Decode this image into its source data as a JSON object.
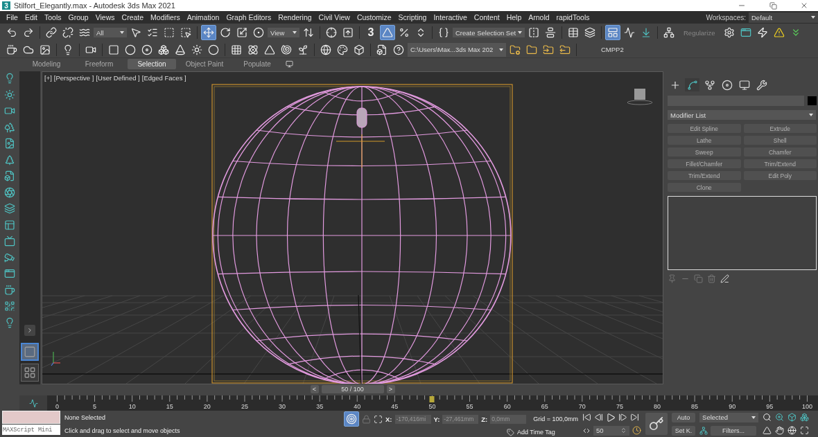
{
  "window": {
    "app_letter": "3",
    "title": "Stilfort_Elegantly.max - Autodesk 3ds Max 2021"
  },
  "menu": [
    "File",
    "Edit",
    "Tools",
    "Group",
    "Views",
    "Create",
    "Modifiers",
    "Animation",
    "Graph Editors",
    "Rendering",
    "Civil View",
    "Customize",
    "Scripting",
    "Interactive",
    "Content",
    "Help",
    "Arnold",
    "rapidTools"
  ],
  "workspaces": {
    "label": "Workspaces:",
    "value": "Default"
  },
  "toolbar": {
    "filter": "All",
    "ref_coord": "View",
    "snap_label": "3",
    "selection_set": "Create Selection Set",
    "regularize": "Regularize",
    "move_active": true,
    "angle_snap_on": true,
    "ribbon_toggle_on": true
  },
  "toolbar2": {
    "project_path": "C:\\Users\\Мак...3ds Max 202",
    "label": "CMPP2"
  },
  "ribbon_tabs": [
    {
      "label": "Modeling",
      "selected": false
    },
    {
      "label": "Freeform",
      "selected": false
    },
    {
      "label": "Selection",
      "selected": true
    },
    {
      "label": "Object Paint",
      "selected": false
    },
    {
      "label": "Populate",
      "selected": false
    }
  ],
  "viewport": {
    "labels": [
      "[+]",
      "[Perspective ]",
      "[User Defined ]",
      "[Edged Faces ]"
    ]
  },
  "command_panel": {
    "tabs": [
      {
        "kind": "create",
        "selected": false
      },
      {
        "kind": "modify",
        "selected": true
      },
      {
        "kind": "hierarchy",
        "selected": false
      },
      {
        "kind": "motion",
        "selected": false
      },
      {
        "kind": "display",
        "selected": false
      },
      {
        "kind": "utilities",
        "selected": false
      }
    ],
    "modifier_list": "Modifier List",
    "modifier_buttons": [
      "Edit Spline",
      "Extrude",
      "Lathe",
      "Shell",
      "Sweep",
      "Chamfer",
      "Fillet/Chamfer",
      "Trim/Extend",
      "Trim/Extend",
      "Edit Poly",
      "Clone"
    ]
  },
  "time_slider": {
    "prev": "<",
    "position": "50 / 100",
    "next": ">",
    "level": 0.5
  },
  "ruler_ticks": [
    "0",
    "5",
    "10",
    "15",
    "20",
    "25",
    "30",
    "35",
    "40",
    "45",
    "50",
    "55",
    "60",
    "65",
    "70",
    "75",
    "80",
    "85",
    "90",
    "95",
    "100"
  ],
  "status": {
    "maxscript": "MAXScript Mini",
    "selection": "None Selected",
    "prompt": "Click and drag to select and move objects",
    "x_label": "X:",
    "x_value": "-170,416mi",
    "y_label": "Y:",
    "y_value": "-27,461mm",
    "z_label": "Z:",
    "z_value": "0,0mm",
    "grid": "Grid = 100,0mm",
    "time_tag": "Add Time Tag",
    "frame": "50",
    "auto": "Auto",
    "set_key": "Set K.",
    "key_filter": "Selected",
    "filters": "Filters..."
  }
}
